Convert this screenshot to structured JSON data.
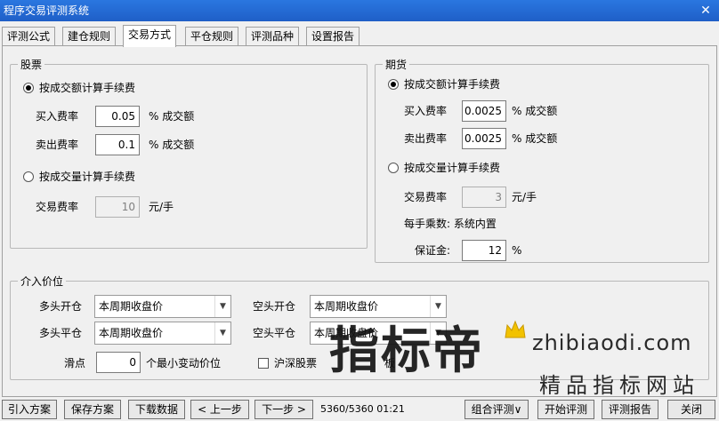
{
  "window": {
    "title": "程序交易评测系统",
    "close_glyph": "✕"
  },
  "tabs": [
    "评测公式",
    "建仓规则",
    "交易方式",
    "平仓规则",
    "评测品种",
    "设置报告"
  ],
  "active_tab": 2,
  "stock": {
    "title": "股票",
    "by_amount_label": "按成交额计算手续费",
    "buy_rate_label": "买入费率",
    "buy_rate_value": "0.05",
    "buy_rate_unit": "% 成交额",
    "sell_rate_label": "卖出费率",
    "sell_rate_value": "0.1",
    "sell_rate_unit": "% 成交额",
    "by_volume_label": "按成交量计算手续费",
    "trade_fee_label": "交易费率",
    "trade_fee_value": "10",
    "trade_fee_unit": "元/手"
  },
  "futures": {
    "title": "期货",
    "by_amount_label": "按成交额计算手续费",
    "buy_rate_label": "买入费率",
    "buy_rate_value": "0.0025",
    "buy_rate_unit": "% 成交额",
    "sell_rate_label": "卖出费率",
    "sell_rate_value": "0.0025",
    "sell_rate_unit": "% 成交额",
    "by_volume_label": "按成交量计算手续费",
    "trade_fee_label": "交易费率",
    "trade_fee_value": "3",
    "trade_fee_unit": "元/手",
    "multiplier_text": "每手乘数: 系统内置",
    "margin_label": "保证金:",
    "margin_value": "12",
    "margin_unit": "%"
  },
  "entry_price": {
    "title": "介入价位",
    "long_open_label": "多头开仓",
    "long_open_value": "本周期收盘价",
    "short_open_label": "空头开仓",
    "short_open_value": "本周期收盘价",
    "long_close_label": "多头平仓",
    "long_close_value": "本周期收盘价",
    "short_close_label": "空头平仓",
    "short_close_value": "本周期收盘价",
    "slippage_label": "滑点",
    "slippage_value": "0",
    "slippage_unit": "个最小变动价位",
    "hs_limit_label": "沪深股票",
    "hs_limit_suffix": "板"
  },
  "footer": {
    "buttons": [
      "引入方案",
      "保存方案",
      "下载数据",
      "< 上一步",
      "下一步 >",
      "组合评测∨",
      "开始评测",
      "评测报告",
      "关闭"
    ],
    "status": "5360/5360  01:21"
  },
  "watermark": {
    "cn": "指标帝",
    "en": "zhibiaodi.com",
    "sub": "精品指标网站"
  }
}
